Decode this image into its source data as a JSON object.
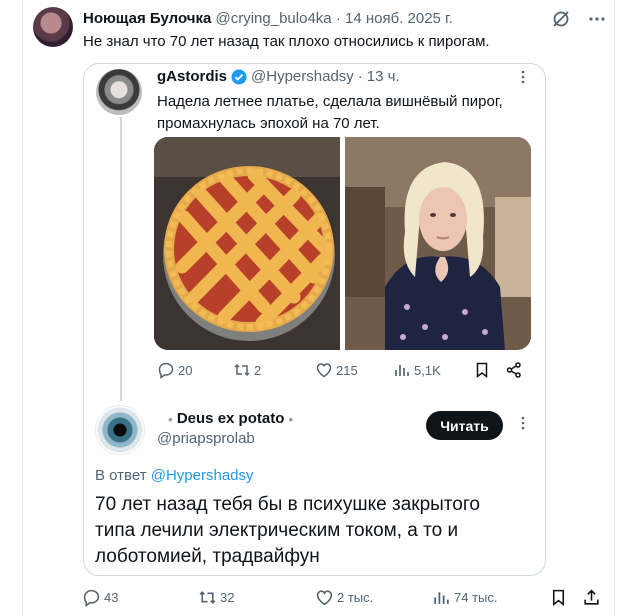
{
  "post": {
    "author_name": "Ноющая Булочка",
    "author_handle": "@crying_bulo4ka",
    "separator": "·",
    "date": "14 нояб. 2025 г.",
    "text": "Не знал что 70 лет назад так плохо относились к пирогам."
  },
  "quoted": {
    "author_name": "gAstordis",
    "author_handle": "@Hypershadsy",
    "separator": "·",
    "time": "13 ч.",
    "text": "Надела летнее платье, сделала вишнёвый пирог, промахнулась эпохой на 70 лет.",
    "images": [
      "cherry-lattice-pie-photo",
      "blonde-woman-floral-dress-photo"
    ],
    "actions": {
      "replies": "20",
      "reposts": "2",
      "likes": "215",
      "views": "5,1K"
    }
  },
  "reply": {
    "author_name": "Deus ex potato",
    "author_handle": "@priapsprolab",
    "button_label": "Читать",
    "replying_prefix": "В ответ",
    "replying_to": "@Hypershadsy",
    "text": "70 лет назад тебя бы в психушке закрытого типа лечили электрическим током, а то и лоботомией, традвайфун"
  },
  "footer_actions": {
    "replies": "43",
    "reposts": "32",
    "likes": "2 тыс.",
    "views": "74 тыс."
  },
  "colors": {
    "link": "#1d9bf0",
    "muted": "#536471",
    "button_bg": "#0f1419",
    "border": "#cfd9de"
  }
}
